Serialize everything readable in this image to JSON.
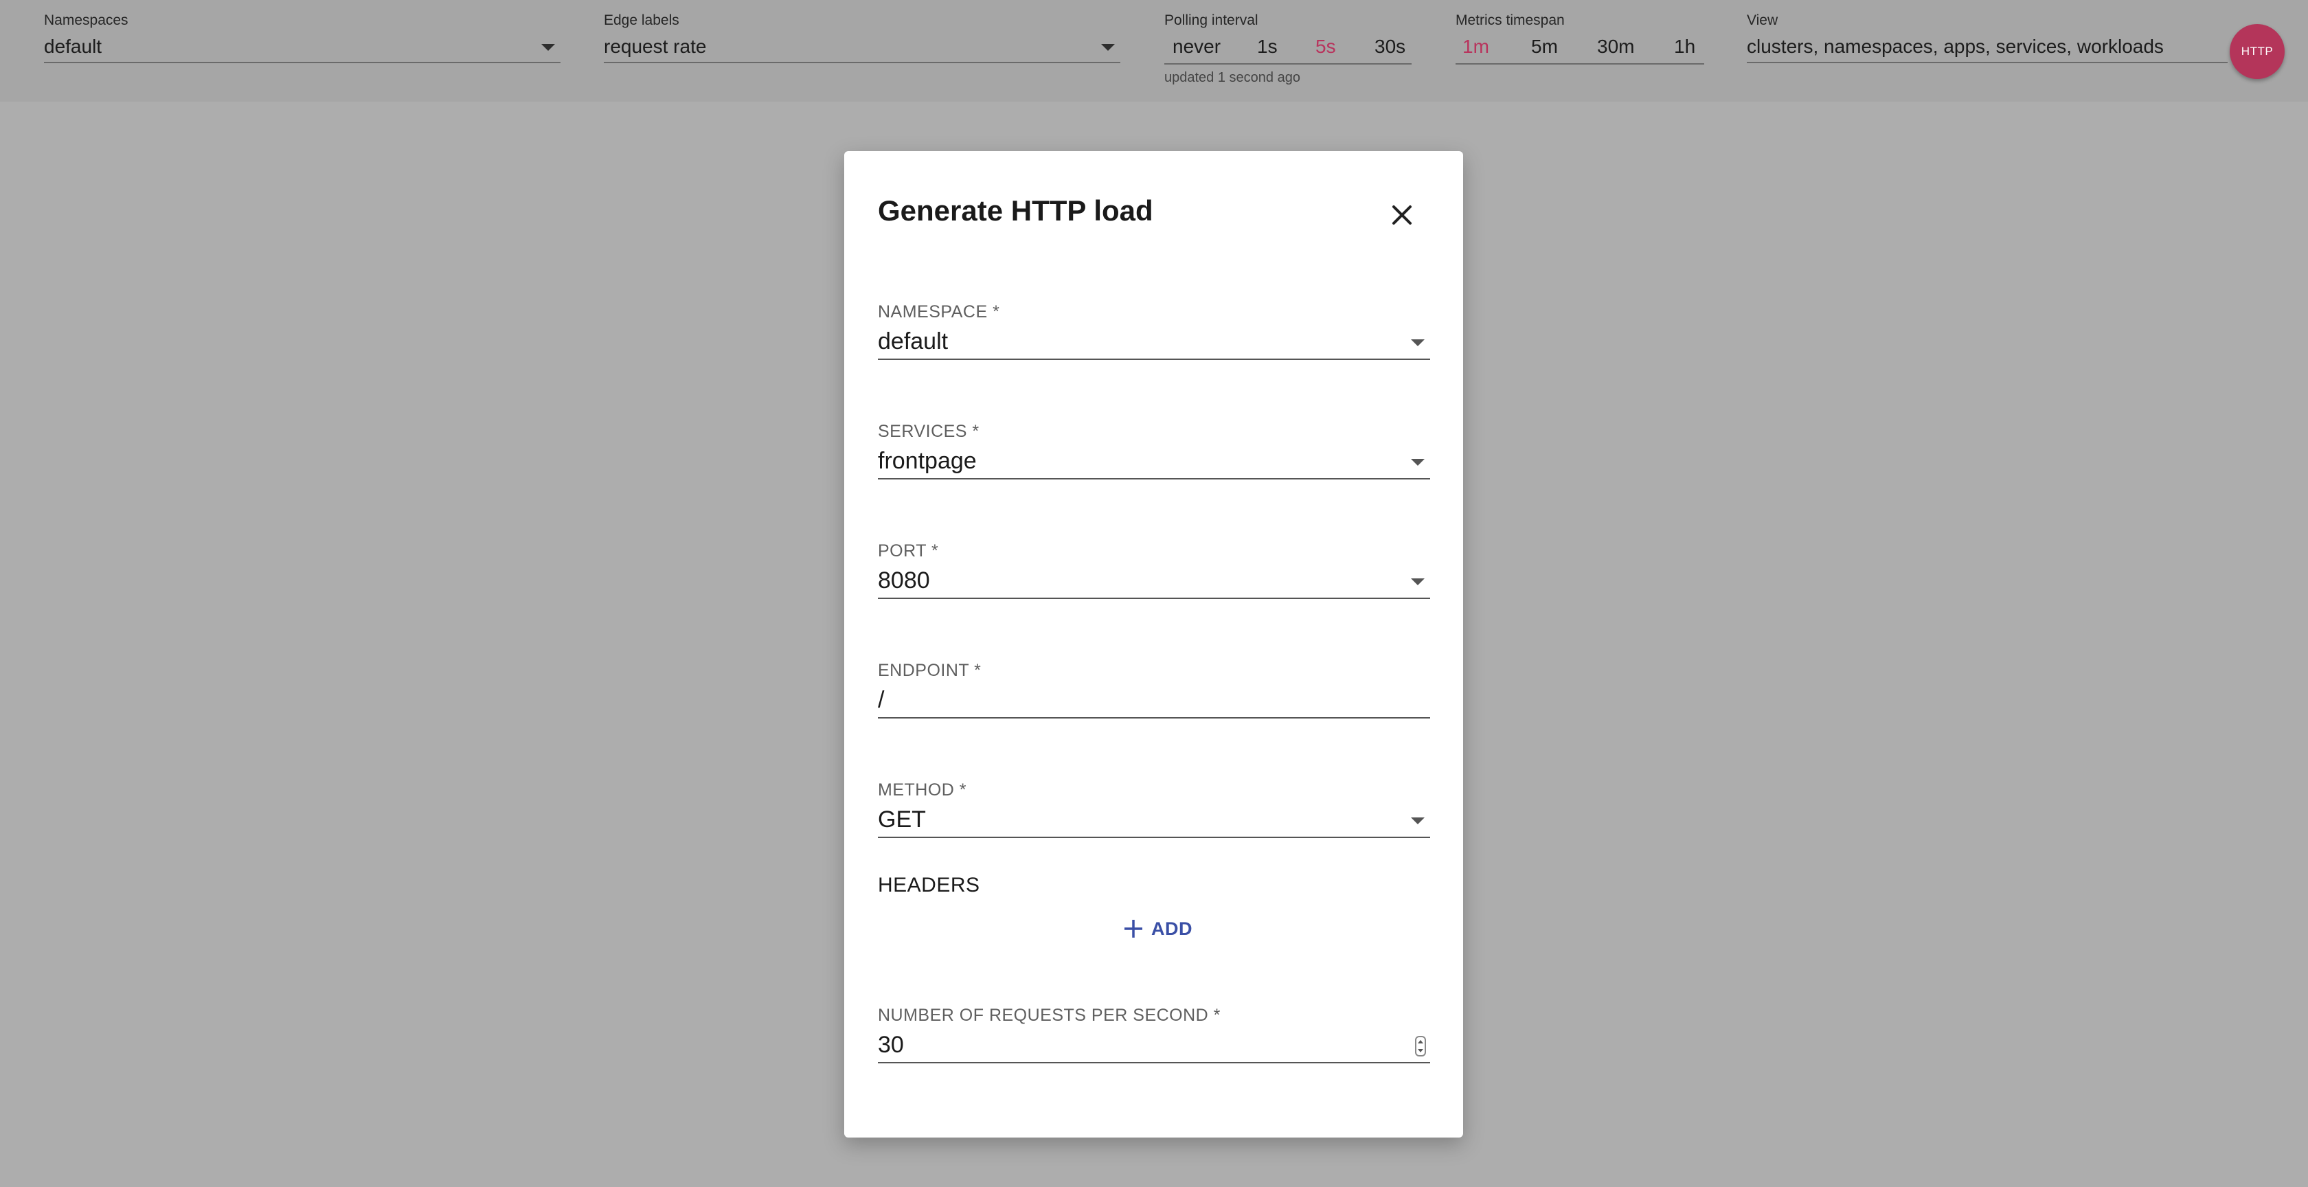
{
  "toolbar": {
    "namespaces": {
      "label": "Namespaces",
      "value": "default"
    },
    "edge_labels": {
      "label": "Edge labels",
      "value": "request rate"
    },
    "polling": {
      "label": "Polling interval",
      "options": [
        "never",
        "1s",
        "5s",
        "30s"
      ],
      "selected": "5s",
      "status": "updated 1 second ago"
    },
    "metrics": {
      "label": "Metrics timespan",
      "options": [
        "1m",
        "5m",
        "30m",
        "1h"
      ],
      "selected": "1m"
    },
    "view": {
      "label": "View",
      "value": "clusters, namespaces, apps, services, workloads"
    },
    "fab_label": "HTTP"
  },
  "dialog": {
    "title": "Generate HTTP load",
    "fields": {
      "namespace": {
        "label": "NAMESPACE *",
        "value": "default"
      },
      "services": {
        "label": "SERVICES *",
        "value": "frontpage"
      },
      "port": {
        "label": "PORT *",
        "value": "8080"
      },
      "endpoint": {
        "label": "ENDPOINT *",
        "value": "/"
      },
      "method": {
        "label": "METHOD *",
        "value": "GET"
      },
      "rps": {
        "label": "NUMBER OF REQUESTS PER SECOND *",
        "value": "30"
      }
    },
    "headers_label": "HEADERS",
    "add_label": "ADD"
  },
  "colors": {
    "accent": "#b8345d",
    "fab": "#b4355a",
    "add_button": "#3a4fa6",
    "overlay": "#adadad"
  }
}
